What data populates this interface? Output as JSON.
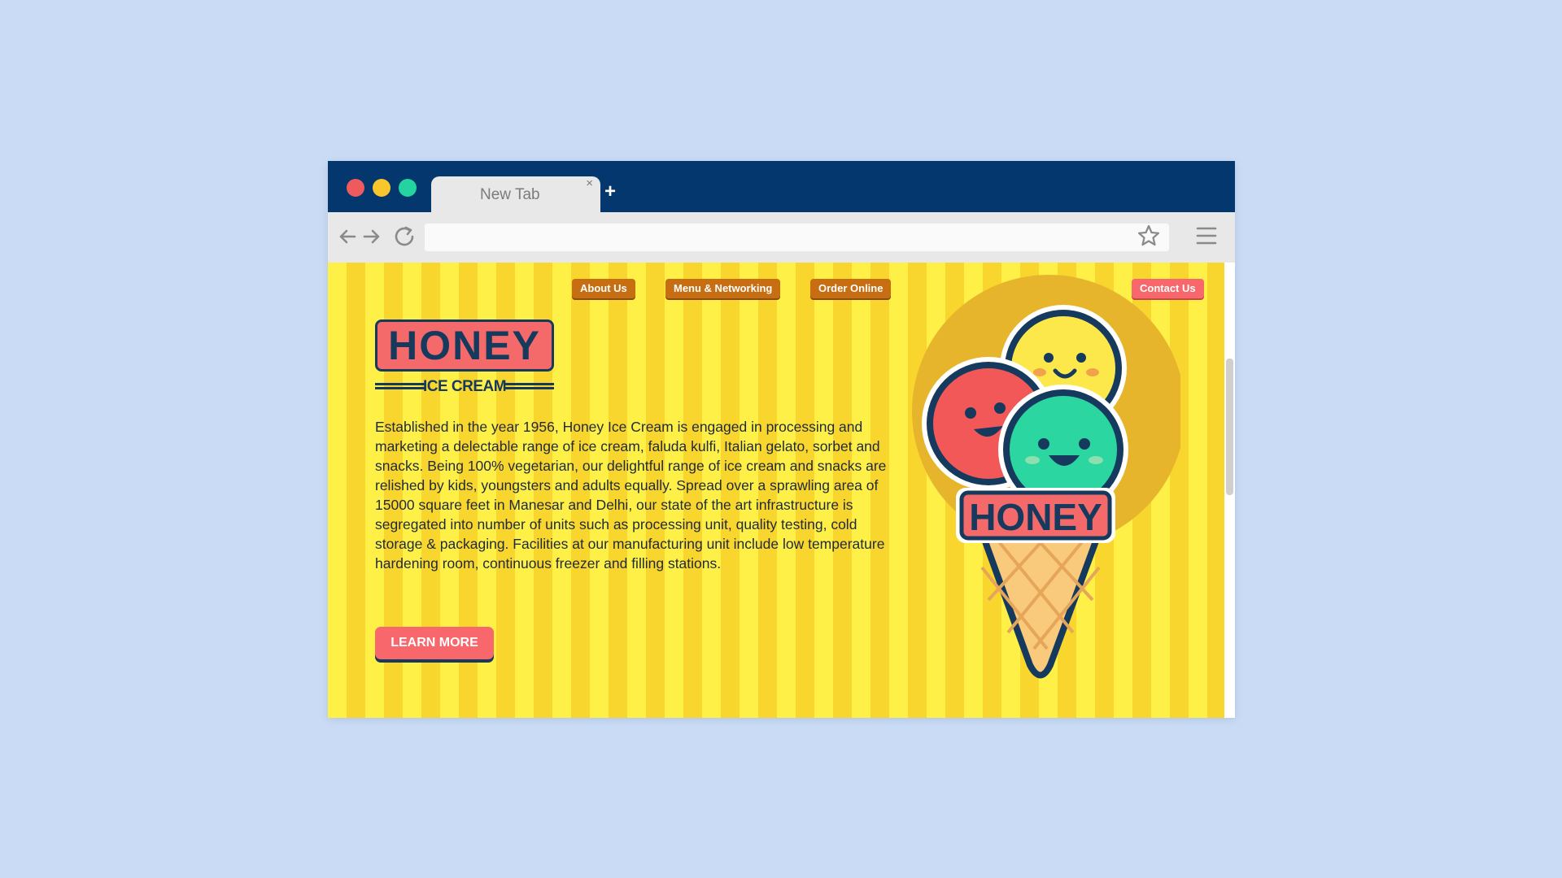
{
  "browser": {
    "tab_title": "New Tab",
    "tab_close": "×",
    "new_tab": "+",
    "address_value": ""
  },
  "site": {
    "nav": {
      "about": "About Us",
      "menu": "Menu & Networking",
      "order": "Order Online",
      "contact": "Contact Us"
    },
    "logo": {
      "word": "HONEY",
      "sub": "ICE CREAM"
    },
    "description": "Established in the year 1956, Honey Ice Cream is engaged in processing and marketing a delectable range of ice cream, faluda kulfi, Italian gelato, sorbet and snacks. Being 100% vegetarian, our delightful range of ice cream and snacks are relished by kids, youngsters and adults equally. Spread over a sprawling area of 15000 square feet in Manesar and Delhi, our state of the art infrastructure is segregated into number of units such as processing unit, quality testing, cold storage & packaging. Facilities at our manufacturing unit include low temperature hardening room, continuous freezer and filling stations.",
    "cta": "LEARN MORE",
    "illustration_label": "HONEY"
  },
  "colors": {
    "background": "#cadcf5",
    "titlebar": "#04376d",
    "stripe_light": "#fff048",
    "stripe_dark": "#f9d62e",
    "coral": "#f7676b",
    "navy": "#163a5e",
    "nav_button": "#c66e11"
  },
  "icons": [
    "back-arrow-icon",
    "forward-arrow-icon",
    "reload-icon",
    "star-icon",
    "hamburger-menu-icon",
    "close-icon",
    "plus-icon"
  ]
}
